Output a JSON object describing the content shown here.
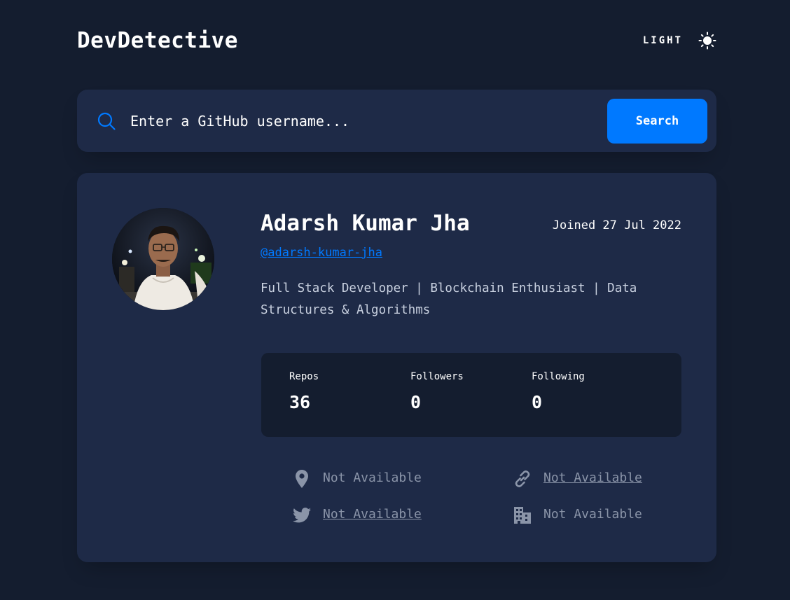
{
  "header": {
    "brand": "DevDetective",
    "mode_label": "LIGHT",
    "mode_icon": "sun-icon"
  },
  "search": {
    "placeholder": "Enter a GitHub username...",
    "button_label": "Search",
    "icon": "search-icon"
  },
  "profile": {
    "name": "Adarsh Kumar Jha",
    "joined": "Joined 27 Jul 2022",
    "username": "@adarsh-kumar-jha",
    "bio": "Full Stack Developer | Blockchain Enthusiast | Data Structures & Algorithms",
    "avatar": "avatar-photo"
  },
  "stats": [
    {
      "label": "Repos",
      "value": "36"
    },
    {
      "label": "Followers",
      "value": "0"
    },
    {
      "label": "Following",
      "value": "0"
    }
  ],
  "links": {
    "location": {
      "icon": "location-pin-icon",
      "text": "Not Available"
    },
    "website": {
      "icon": "link-icon",
      "text": "Not Available"
    },
    "twitter": {
      "icon": "twitter-icon",
      "text": "Not Available"
    },
    "company": {
      "icon": "building-icon",
      "text": "Not Available"
    }
  },
  "colors": {
    "background": "#141d2f",
    "card": "#1e2a47",
    "accent": "#0079ff",
    "muted": "#8a94a8",
    "text": "#ffffff"
  }
}
